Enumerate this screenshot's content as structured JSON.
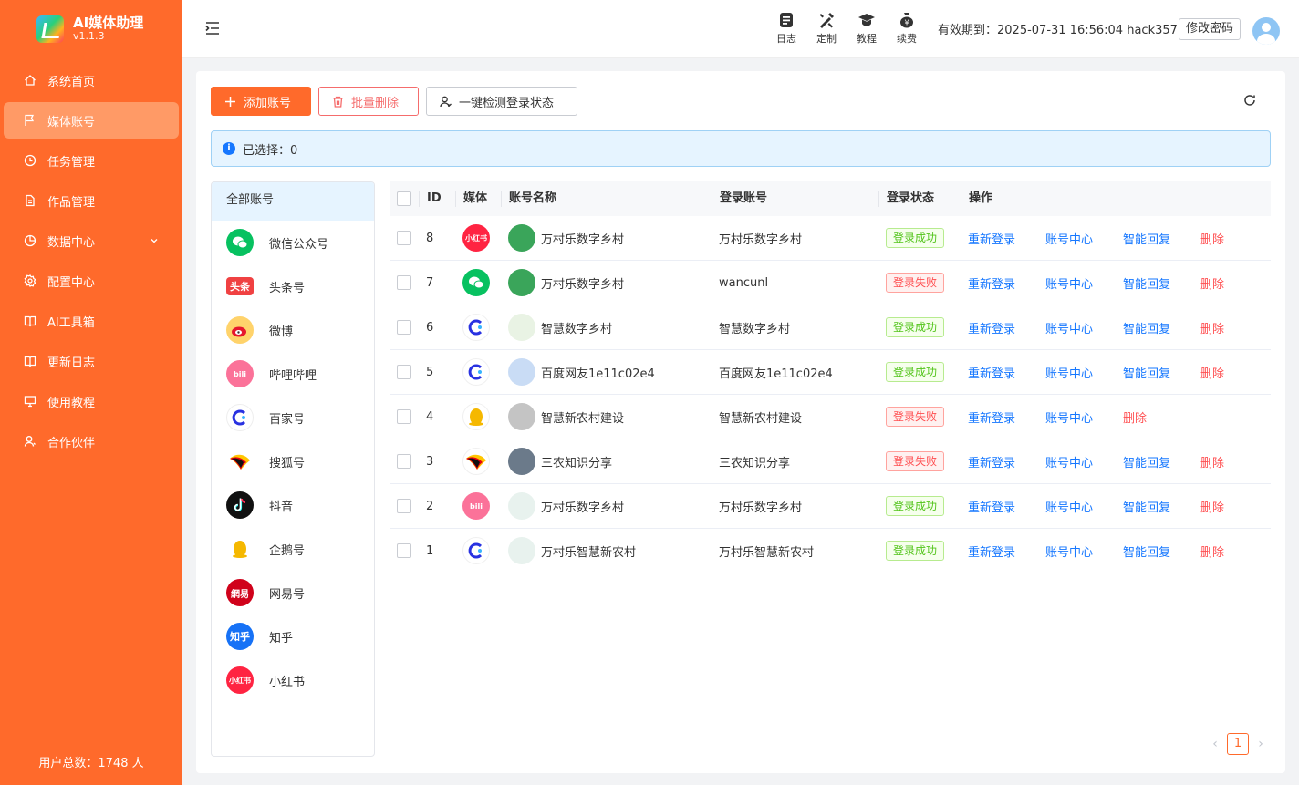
{
  "app": {
    "title": "AI媒体助理",
    "version": "v1.1.3"
  },
  "sidebar": {
    "items": [
      {
        "label": "系统首页",
        "icon": "home-icon"
      },
      {
        "label": "媒体账号",
        "icon": "flag-icon",
        "active": true
      },
      {
        "label": "任务管理",
        "icon": "clock-icon"
      },
      {
        "label": "作品管理",
        "icon": "document-icon"
      },
      {
        "label": "数据中心",
        "icon": "chart-icon"
      },
      {
        "label": "配置中心",
        "icon": "gear-icon"
      },
      {
        "label": "AI工具箱",
        "icon": "book-icon"
      },
      {
        "label": "更新日志",
        "icon": "book-icon"
      },
      {
        "label": "使用教程",
        "icon": "monitor-icon"
      },
      {
        "label": "合作伙伴",
        "icon": "user-icon"
      }
    ],
    "footer": "用户总数：1748 人"
  },
  "header": {
    "tools": [
      "日志",
      "定制",
      "教程",
      "续费"
    ],
    "expire": "有效期到：2025-07-31 16:56:04",
    "username": "hack357",
    "change_password": "修改密码"
  },
  "toolbar": {
    "add": "添加账号",
    "batch_delete": "批量删除",
    "check_login": "一键检测登录状态"
  },
  "alert": {
    "selected": "已选择：0"
  },
  "platforms": {
    "all": "全部账号",
    "items": [
      "微信公众号",
      "头条号",
      "微博",
      "哔哩哔哩",
      "百家号",
      "搜狐号",
      "抖音",
      "企鹅号",
      "网易号",
      "知乎",
      "小红书"
    ]
  },
  "table": {
    "headers": {
      "id": "ID",
      "media": "媒体",
      "name": "账号名称",
      "login": "登录账号",
      "status": "登录状态",
      "ops": "操作"
    },
    "op_labels": {
      "relogin": "重新登录",
      "center": "账号中心",
      "reply": "智能回复",
      "delete": "删除"
    },
    "rows": [
      {
        "id": "8",
        "media": "小红书",
        "name": "万村乐数字乡村",
        "login": "万村乐数字乡村",
        "status": "登录成功",
        "ok": true,
        "reply": true
      },
      {
        "id": "7",
        "media": "微信公众号",
        "name": "万村乐数字乡村",
        "login": "wancunl",
        "status": "登录失败",
        "ok": false,
        "reply": true
      },
      {
        "id": "6",
        "media": "百家号",
        "name": "智慧数字乡村",
        "login": "智慧数字乡村",
        "status": "登录成功",
        "ok": true,
        "reply": true
      },
      {
        "id": "5",
        "media": "百家号",
        "name": "百度网友1e11c02e4",
        "login": "百度网友1e11c02e4",
        "status": "登录成功",
        "ok": true,
        "reply": true
      },
      {
        "id": "4",
        "media": "企鹅号",
        "name": "智慧新农村建设",
        "login": "智慧新农村建设",
        "status": "登录失败",
        "ok": false,
        "reply": false
      },
      {
        "id": "3",
        "media": "搜狐号",
        "name": "三农知识分享",
        "login": "三农知识分享",
        "status": "登录失败",
        "ok": false,
        "reply": true
      },
      {
        "id": "2",
        "media": "哔哩哔哩",
        "name": "万村乐数字乡村",
        "login": "万村乐数字乡村",
        "status": "登录成功",
        "ok": true,
        "reply": true
      },
      {
        "id": "1",
        "media": "百家号",
        "name": "万村乐智慧新农村",
        "login": "万村乐智慧新农村",
        "status": "登录成功",
        "ok": true,
        "reply": true
      }
    ]
  },
  "pagination": {
    "current": "1"
  },
  "colors": {
    "brand": "#ff6a2b",
    "link": "#1677ff",
    "danger": "#ff4d4f",
    "success": "#52c41a"
  }
}
